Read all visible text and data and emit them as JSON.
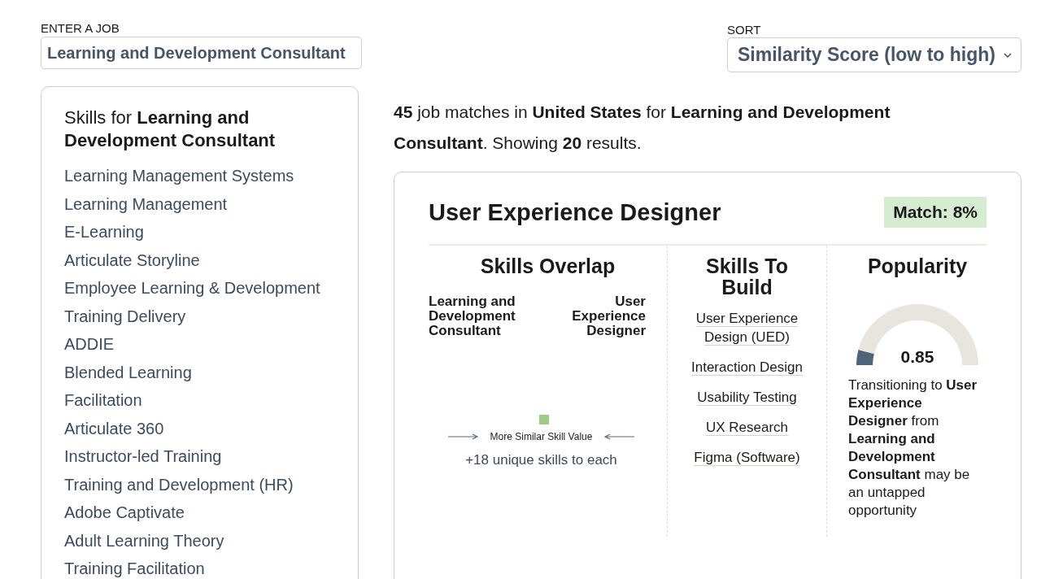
{
  "job_input": {
    "label": "ENTER A JOB",
    "value": "Learning and Development Consultant"
  },
  "sort": {
    "label": "SORT",
    "value": "Similarity Score (low to high)"
  },
  "skills_panel": {
    "title": "Skills for **Learning and Development Consultant**",
    "skills": [
      "Learning Management Systems",
      "Learning Management",
      "E-Learning",
      "Articulate Storyline",
      "Employee Learning & Development",
      "Training Delivery",
      "ADDIE",
      "Blended Learning",
      "Facilitation",
      "Articulate 360",
      "Instructor-led Training",
      "Training and Development (HR)",
      "Adobe Captivate",
      "Adult Learning Theory",
      "Training Facilitation"
    ]
  },
  "summary": "**45** job matches in **United States** for **Learning and Development Consultant**. Showing **20** results.",
  "result_card": {
    "title": "User Experience Designer",
    "match": "Match: 8%",
    "overlap": {
      "heading": "Skills Overlap",
      "left_job": "Learning and Development Consultant",
      "right_job": "User Experience Designer",
      "axis_label": "More Similar Skill Value",
      "unique": "+18 unique skills to each"
    },
    "build": {
      "heading": "Skills To Build",
      "skills": [
        "User Experience Design (UED)",
        "Interaction Design",
        "Usability Testing",
        "UX Research",
        "Figma (Software)"
      ]
    },
    "popularity": {
      "heading": "Popularity",
      "level": 0.08,
      "score": "0.85",
      "text": "Transitioning to **User Experience Designer** from **Learning and Development Consultant** may be an untapped opportunity"
    }
  }
}
